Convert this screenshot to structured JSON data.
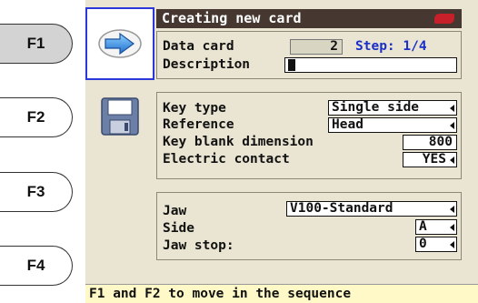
{
  "fkeys": [
    {
      "label": "F1",
      "active": true
    },
    {
      "label": "F2",
      "active": false
    },
    {
      "label": "F3",
      "active": false
    },
    {
      "label": "F4",
      "active": false
    }
  ],
  "title": "Creating new card",
  "data_card": {
    "label": "Data card",
    "value": "2",
    "step": "Step: 1/4"
  },
  "description": {
    "label": "Description",
    "value": ""
  },
  "key_section": {
    "key_type": {
      "label": "Key type",
      "value": "Single side"
    },
    "reference": {
      "label": "Reference",
      "value": "Head"
    },
    "blank_dimension": {
      "label": "Key blank dimension",
      "value": "800"
    },
    "electric_contact": {
      "label": "Electric contact",
      "value": "YES"
    }
  },
  "jaw_section": {
    "jaw": {
      "label": "Jaw",
      "value": "V100-Standard"
    },
    "side": {
      "label": "Side",
      "value": "A"
    },
    "jaw_stop": {
      "label": "Jaw stop:",
      "value": "0"
    }
  },
  "status": "F1 and F2 to move in the sequence",
  "icons": [
    "next-arrow-icon",
    "save-floppy-icon"
  ],
  "colors": {
    "title_bg": "#463830",
    "screen_bg": "#e9e5d2",
    "highlight_border": "#2b37d8",
    "step_text": "#1a2fc8",
    "status_bg": "#fff9c8"
  }
}
